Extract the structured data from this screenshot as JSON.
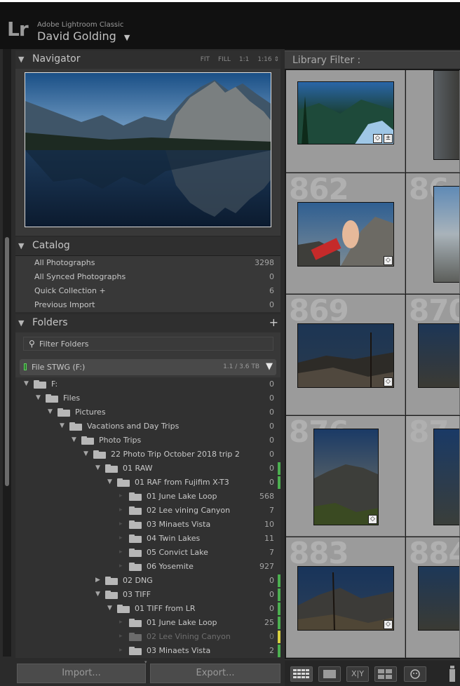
{
  "app": {
    "logo": "Lr",
    "product_name": "Adobe Lightroom Classic",
    "user_name": "David Golding",
    "user_caret": "▼"
  },
  "navigator": {
    "title": "Navigator",
    "zoom_options": [
      "FIT",
      "FILL",
      "1:1",
      "1:16 ⇕"
    ]
  },
  "catalog": {
    "title": "Catalog",
    "items": [
      {
        "label": "All Photographs",
        "count": "3298"
      },
      {
        "label": "All Synced Photographs",
        "count": "0"
      },
      {
        "label": "Quick Collection  +",
        "count": "6"
      },
      {
        "label": "Previous Import",
        "count": "0"
      }
    ]
  },
  "folders": {
    "title": "Folders",
    "add_symbol": "+",
    "filter_placeholder": "Filter Folders",
    "volume": {
      "label": "File STWG (F:)",
      "size": "1.1 / 3.6 TB"
    },
    "tree": [
      {
        "name": "F:",
        "count": "0",
        "depth": 0,
        "expanded": true
      },
      {
        "name": "Files",
        "count": "0",
        "depth": 1,
        "expanded": true
      },
      {
        "name": "Pictures",
        "count": "0",
        "depth": 2,
        "expanded": true
      },
      {
        "name": "Vacations and Day Trips",
        "count": "0",
        "depth": 3,
        "expanded": true
      },
      {
        "name": "Photo Trips",
        "count": "0",
        "depth": 4,
        "expanded": true
      },
      {
        "name": "22 Photo Trip October 2018 trip 2",
        "count": "0",
        "depth": 5,
        "expanded": true
      },
      {
        "name": "01 RAW",
        "count": "0",
        "depth": 6,
        "expanded": true,
        "marker": "#4caf50"
      },
      {
        "name": "01 RAF from Fujifim X-T3",
        "count": "0",
        "depth": 7,
        "expanded": true,
        "marker": "#4caf50"
      },
      {
        "name": "01 June Lake Loop",
        "count": "568",
        "depth": 8,
        "leaf": true
      },
      {
        "name": "02 Lee vining Canyon",
        "count": "7",
        "depth": 8,
        "leaf": true
      },
      {
        "name": "03 Minaets Vista",
        "count": "10",
        "depth": 8,
        "leaf": true
      },
      {
        "name": "04 Twin Lakes",
        "count": "11",
        "depth": 8,
        "leaf": true
      },
      {
        "name": "05 Convict Lake",
        "count": "7",
        "depth": 8,
        "leaf": true
      },
      {
        "name": "06 Yosemite",
        "count": "927",
        "depth": 8,
        "leaf": true
      },
      {
        "name": "02 DNG",
        "count": "0",
        "depth": 6,
        "expanded": false,
        "marker": "#4caf50"
      },
      {
        "name": "03 TIFF",
        "count": "0",
        "depth": 6,
        "expanded": true,
        "marker": "#4caf50"
      },
      {
        "name": "01 TIFF from LR",
        "count": "0",
        "depth": 7,
        "expanded": true,
        "marker": "#4caf50"
      },
      {
        "name": "01 June Lake Loop",
        "count": "25",
        "depth": 8,
        "leaf": true,
        "marker": "#4caf50"
      },
      {
        "name": "02 Lee Vining Canyon",
        "count": "0",
        "depth": 8,
        "leaf": true,
        "dim": true,
        "marker": "#d8d040"
      },
      {
        "name": "03 Minaets Vista",
        "count": "2",
        "depth": 8,
        "leaf": true,
        "marker": "#4caf50"
      }
    ]
  },
  "buttons": {
    "import": "Import...",
    "export": "Export..."
  },
  "library_filter": {
    "label": "Library Filter :"
  },
  "grid": {
    "cell_numbers": [
      "862",
      "869",
      "876",
      "883"
    ],
    "partial_numbers": [
      "86",
      "870",
      "87",
      "884"
    ],
    "compare_label": "X|Y"
  }
}
